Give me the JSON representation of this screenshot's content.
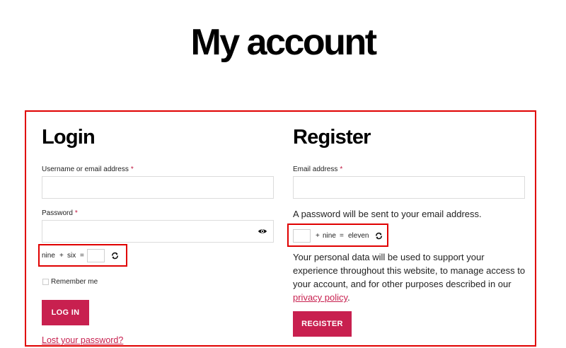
{
  "page": {
    "title": "My account"
  },
  "login": {
    "heading": "Login",
    "username_label": "Username or email address",
    "password_label": "Password",
    "required_mark": "*",
    "captcha": {
      "left": "nine",
      "op": "+",
      "right": "six",
      "eq": "="
    },
    "remember_label": "Remember me",
    "button_label": "LOG IN",
    "lost_password": "Lost your password?"
  },
  "register": {
    "heading": "Register",
    "email_label": "Email address",
    "required_mark": "*",
    "password_note": "A password will be sent to your email address.",
    "captcha": {
      "op": "+",
      "middle": "nine",
      "eq": "=",
      "result": "eleven"
    },
    "privacy_text": "Your personal data will be used to support your experience throughout this website, to manage access to your account, and for other purposes described in our",
    "privacy_link": "privacy policy",
    "privacy_end": ".",
    "button_label": "REGISTER"
  },
  "colors": {
    "accent": "#c8204f",
    "highlight": "#e00000"
  },
  "icons": {
    "password_toggle": "eye-icon",
    "captcha_refresh": "refresh-icon"
  }
}
